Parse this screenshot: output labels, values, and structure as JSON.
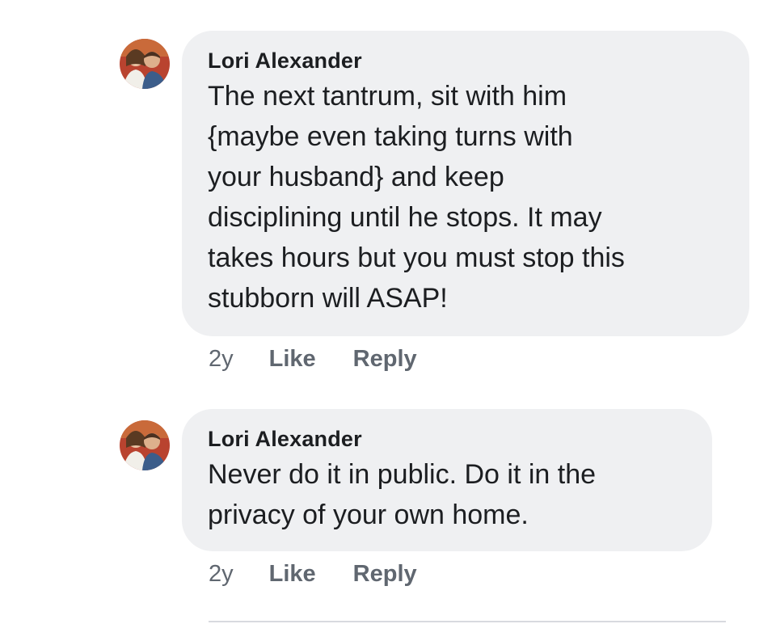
{
  "comments": [
    {
      "author": "Lori Alexander",
      "text": "The next tantrum, sit with him\n{maybe even taking turns with\nyour husband} and keep\ndisciplining until he stops. It may\ntakes hours but you must stop this\nstubborn will ASAP!",
      "time": "2y",
      "like_label": "Like",
      "reply_label": "Reply",
      "avatar_icon": "profile-photo-couple"
    },
    {
      "author": "Lori Alexander",
      "text": "Never do it in public. Do it in the\nprivacy of your own home.",
      "time": "2y",
      "like_label": "Like",
      "reply_label": "Reply",
      "avatar_icon": "profile-photo-couple"
    }
  ],
  "colors": {
    "bubble_background": "#eff0f2",
    "meta_text": "#606770",
    "body_text": "#1c1e21"
  }
}
